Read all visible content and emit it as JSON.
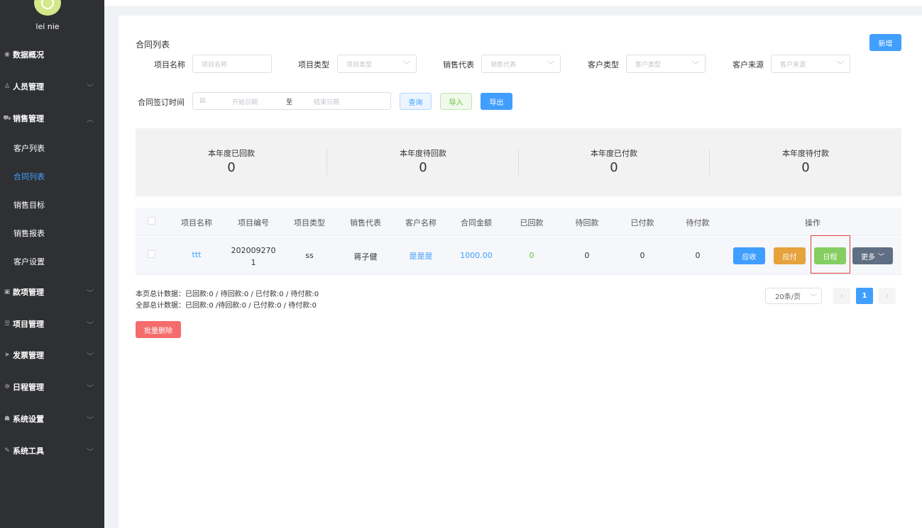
{
  "user": {
    "name": "lei nie"
  },
  "sidebar": {
    "groups": [
      {
        "label": "数据概况",
        "icon": "dashboard-icon"
      },
      {
        "label": "人员管理",
        "icon": "user-icon"
      },
      {
        "label": "销售管理",
        "icon": "cart-icon"
      },
      {
        "label": "款项管理",
        "icon": "money-icon"
      },
      {
        "label": "项目管理",
        "icon": "database-icon"
      },
      {
        "label": "发票管理",
        "icon": "send-icon"
      },
      {
        "label": "日程管理",
        "icon": "gear-icon"
      },
      {
        "label": "系统设置",
        "icon": "users-icon"
      },
      {
        "label": "系统工具",
        "icon": "wrench-icon"
      }
    ],
    "sales_sub": [
      "客户列表",
      "合同列表",
      "销售目标",
      "销售报表",
      "客户设置"
    ],
    "active_sub": "合同列表"
  },
  "page": {
    "title": "合同列表",
    "new_button": "新增"
  },
  "filters": {
    "project_name": {
      "label": "项目名称",
      "placeholder": "项目名称"
    },
    "project_type": {
      "label": "项目类型",
      "placeholder": "项目类型"
    },
    "sales_rep": {
      "label": "销售代表",
      "placeholder": "销售代表"
    },
    "customer_type": {
      "label": "客户类型",
      "placeholder": "客户类型"
    },
    "customer_source": {
      "label": "客户来源",
      "placeholder": "客户来源"
    },
    "sign_date": {
      "label": "合同签订时间",
      "start": "开始日期",
      "sep": "至",
      "end": "结束日期"
    },
    "query_button": "查询",
    "import_button": "导入",
    "export_button": "导出"
  },
  "summary": [
    {
      "label": "本年度已回款",
      "value": "0"
    },
    {
      "label": "本年度待回款",
      "value": "0"
    },
    {
      "label": "本年度已付款",
      "value": "0"
    },
    {
      "label": "本年度待付款",
      "value": "0"
    }
  ],
  "table": {
    "headers": [
      "项目名称",
      "项目编号",
      "项目类型",
      "销售代表",
      "客户名称",
      "合同金额",
      "已回款",
      "待回款",
      "已付款",
      "待付款",
      "操作"
    ],
    "rows": [
      {
        "name": "ttt",
        "code_line1": "202009270",
        "code_line2": "1",
        "type": "ss",
        "rep": "蒋子健",
        "customer": "是是是",
        "amount": "1000.00",
        "received": "0",
        "to_receive": "0",
        "paid": "0",
        "to_pay": "0",
        "actions": {
          "receive": "应收",
          "pay": "应付",
          "schedule": "日程",
          "more": "更多"
        }
      }
    ]
  },
  "totals": {
    "page_line": "本页总计数据：已回款:0 / 待回款:0 / 已付款:0 / 待付款:0",
    "all_line": "全部总计数据：已回款:0 /待回款:0 / 已付款:0 / 待付款:0"
  },
  "batch_delete": "批量删除",
  "pagination": {
    "page_size": "20条/页",
    "current_page": "1"
  },
  "colors": {
    "primary": "#409eff",
    "sidebar_bg": "#2f3033",
    "warning": "#e6a23c",
    "success": "#85ce61",
    "danger": "#f56c6c"
  }
}
